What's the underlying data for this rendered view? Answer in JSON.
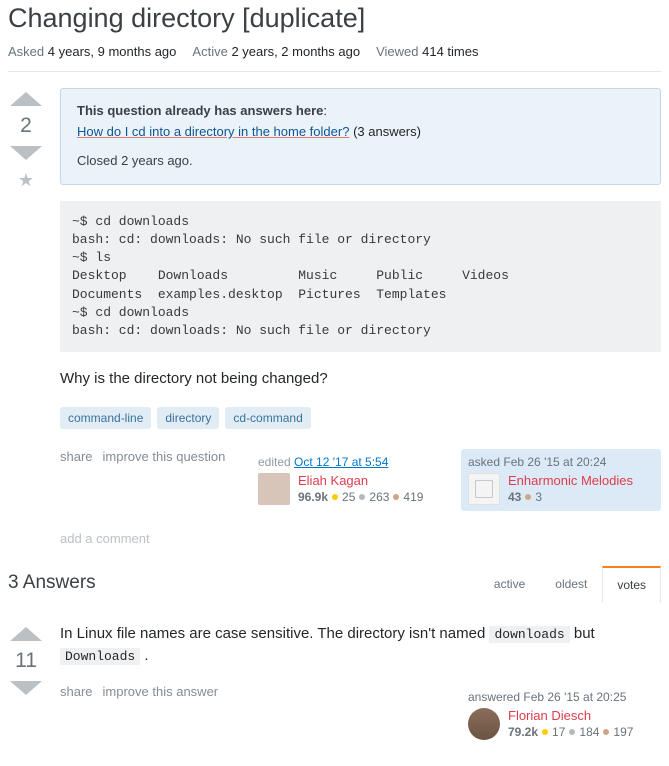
{
  "question": {
    "title": "Changing directory [duplicate]",
    "meta": {
      "asked_label": "Asked",
      "asked_val": "4 years, 9 months ago",
      "active_label": "Active",
      "active_val": "2 years, 2 months ago",
      "viewed_label": "Viewed",
      "viewed_val": "414 times"
    },
    "votes": "2",
    "notice": {
      "heading": "This question already has answers here",
      "dup_link": "How do I cd into a directory in the home folder?",
      "dup_count": "(3 answers)",
      "closed": "Closed 2 years ago."
    },
    "code": "~$ cd downloads\nbash: cd: downloads: No such file or directory\n~$ ls\nDesktop    Downloads         Music     Public     Videos\nDocuments  examples.desktop  Pictures  Templates\n~$ cd downloads\nbash: cd: downloads: No such file or directory",
    "prose": "Why is the directory not being changed?",
    "tags": [
      "command-line",
      "directory",
      "cd-command"
    ],
    "menu": {
      "share": "share",
      "improve": "improve this question"
    },
    "editor": {
      "action": "edited",
      "ts": "Oct 12 '17 at 5:54",
      "name": "Eliah Kagan",
      "rep": "96.9k",
      "gold": "25",
      "silver": "263",
      "bronze": "419"
    },
    "owner": {
      "action": "asked",
      "ts": "Feb 26 '15 at 20:24",
      "name": "Enharmonic Melodies",
      "rep": "43",
      "bronze": "3"
    },
    "add_comment": "add a comment"
  },
  "answers": {
    "heading": "3 Answers",
    "tabs": {
      "active": "active",
      "oldest": "oldest",
      "votes": "votes"
    }
  },
  "answer1": {
    "votes": "11",
    "prose_pre": "In Linux file names are case sensitive. The directory isn't named ",
    "code1": "downloads",
    "prose_mid": " but ",
    "code2": "Downloads",
    "prose_post": " .",
    "menu": {
      "share": "share",
      "improve": "improve this answer"
    },
    "owner": {
      "action": "answered",
      "ts": "Feb 26 '15 at 20:25",
      "name": "Florian Diesch",
      "rep": "79.2k",
      "gold": "17",
      "silver": "184",
      "bronze": "197"
    }
  }
}
